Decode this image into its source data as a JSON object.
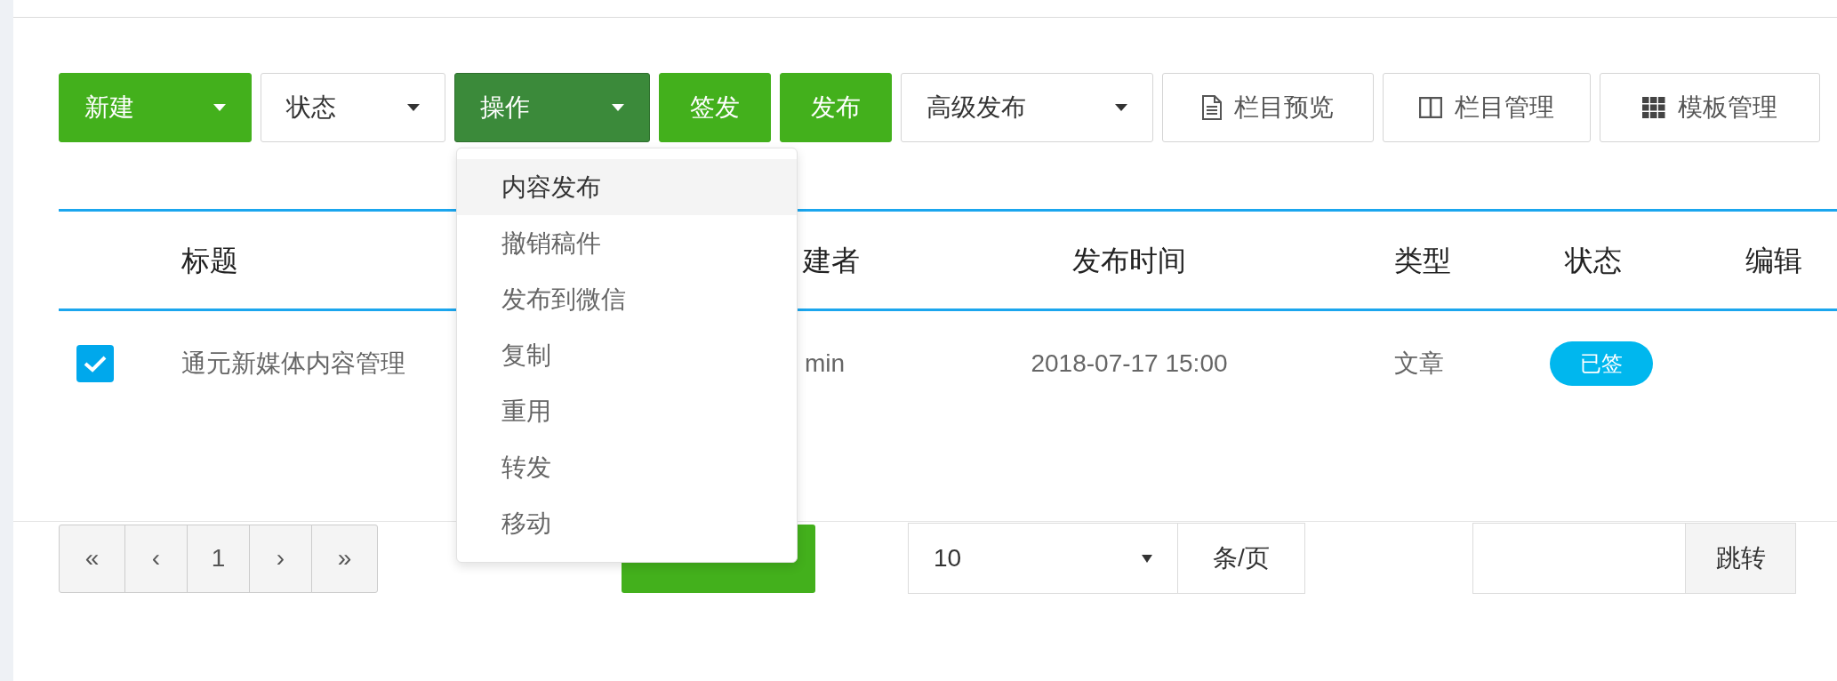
{
  "toolbar": [
    {
      "label": "新建",
      "kind": "primary_dropdown",
      "open": false
    },
    {
      "label": "状态",
      "kind": "dropdown",
      "open": false
    },
    {
      "label": "操作",
      "kind": "primary_dropdown",
      "open": true
    },
    {
      "label": "签发",
      "kind": "primary_button",
      "open": false
    },
    {
      "label": "发布",
      "kind": "primary_button",
      "open": false
    },
    {
      "label": "高级发布",
      "kind": "dropdown",
      "open": false
    },
    {
      "label": "栏目预览",
      "kind": "icon_button",
      "open": false
    },
    {
      "label": "栏目管理",
      "kind": "icon_button",
      "open": false
    },
    {
      "label": "模板管理",
      "kind": "icon_button",
      "open": false
    }
  ],
  "action_menu": {
    "items": [
      {
        "label": "内容发布",
        "highlighted": true
      },
      {
        "label": "撤销稿件",
        "highlighted": false
      },
      {
        "label": "发布到微信",
        "highlighted": false
      },
      {
        "label": "复制",
        "highlighted": false
      },
      {
        "label": "重用",
        "highlighted": false
      },
      {
        "label": "转发",
        "highlighted": false
      },
      {
        "label": "移动",
        "highlighted": false
      }
    ]
  },
  "table": {
    "columns": [
      "标题",
      "建者",
      "发布时间",
      "类型",
      "状态",
      "编辑"
    ],
    "rows": [
      {
        "checked": true,
        "title": "通元新媒体内容管理",
        "creator": "min",
        "publish_time": "2018-07-17 15:00",
        "type": "文章",
        "status": "已签"
      }
    ]
  },
  "pagination": {
    "buttons": [
      "«",
      "‹",
      "1",
      "›",
      "»"
    ]
  },
  "page_size": {
    "value": "10",
    "unit": "条/页"
  },
  "jump": {
    "button": "跳转"
  }
}
